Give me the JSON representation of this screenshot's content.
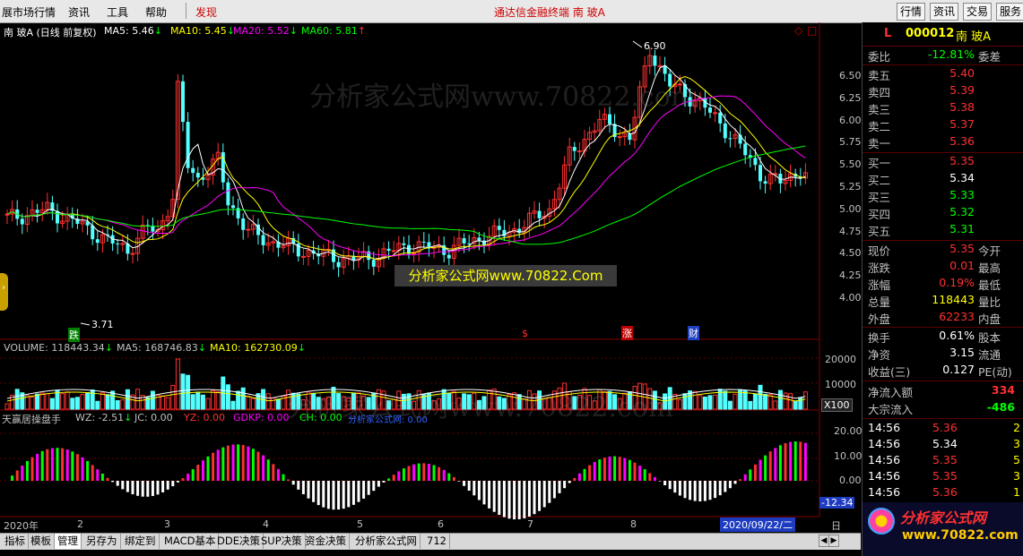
{
  "menu": {
    "items": [
      "展市场行情",
      "资讯",
      "工具",
      "帮助",
      "发现"
    ],
    "center_title": "通达信金融终端   南 玻A",
    "toolbar": [
      "行情",
      "资讯",
      "交易",
      "服务"
    ]
  },
  "main_chart": {
    "stock_label": "南 玻A (日线 前复权)",
    "ma": [
      {
        "label": "MA5: 5.46",
        "arrow": "↓",
        "color": "#ffffff"
      },
      {
        "label": "MA10: 5.45",
        "arrow": "↓",
        "color": "#ffff00"
      },
      {
        "label": "MA20: 5.52",
        "arrow": "↓",
        "color": "#ff00ff"
      },
      {
        "label": "MA60: 5.81",
        "arrow": "↑",
        "color": "#00ff00"
      }
    ],
    "y_ticks": [
      "6.50",
      "6.25",
      "6.00",
      "5.75",
      "5.50",
      "5.25",
      "5.00",
      "4.75",
      "4.50",
      "4.25",
      "4.00"
    ],
    "high_label": "6.90",
    "low_label": "3.71",
    "markers": [
      "跌",
      "$",
      "涨",
      "财"
    ],
    "watermark": "分析家公式网www.70822.com",
    "banner": "分析家公式网www.70822.Com",
    "icons": [
      "diamond-icon",
      "square-icon"
    ]
  },
  "volume_chart": {
    "label": "VOLUME: 118443.34",
    "arrow": "↓",
    "ma5": "MA5: 168746.83",
    "ma5_arrow": "↓",
    "ma10": "MA10: 162730.09",
    "ma10_arrow": "↓",
    "y_ticks": [
      "20000",
      "10000"
    ],
    "unit": "X100"
  },
  "indicator_chart": {
    "name": "天赢居操盘手",
    "items": [
      {
        "label": "WZ: -2.51",
        "arrow": "↓",
        "color": "#c0c0c0"
      },
      {
        "label": "JC: 0.00",
        "arrow": "",
        "color": "#c0c0c0"
      },
      {
        "label": "YZ: 0.00",
        "arrow": "",
        "color": "#ff3030"
      },
      {
        "label": "GDKP: 0.00",
        "arrow": "",
        "color": "#ff00ff"
      },
      {
        "label": "CH: 0.00",
        "arrow": "",
        "color": "#00ff00"
      },
      {
        "label": "分析家公式网: 0.00",
        "arrow": "",
        "color": "#3060ff"
      }
    ],
    "y_ticks": [
      "20.00",
      "10.00",
      "0.00"
    ],
    "current": "-12.34"
  },
  "date_axis": {
    "year": "2020年",
    "months": [
      "2",
      "3",
      "4",
      "5",
      "6",
      "7",
      "8"
    ],
    "current_date": "2020/09/22/二",
    "right_label": "日"
  },
  "tabs": [
    "指标",
    "模板",
    "管理",
    "另存为",
    "绑定到",
    "MACD基本",
    "DDE决策",
    "SUP决策",
    "资金决策",
    "分析家公式网",
    "712"
  ],
  "panel": {
    "code_prefix": "L",
    "code": "000012",
    "name": "南 玻A",
    "weibi_label": "委比",
    "weibi_value": "-12.81%",
    "weicha_label": "委差",
    "sells": [
      {
        "label": "卖五",
        "price": "5.40"
      },
      {
        "label": "卖四",
        "price": "5.39"
      },
      {
        "label": "卖三",
        "price": "5.38"
      },
      {
        "label": "卖二",
        "price": "5.37"
      },
      {
        "label": "卖一",
        "price": "5.36"
      }
    ],
    "buys": [
      {
        "label": "买一",
        "price": "5.35",
        "color": "#ff3030"
      },
      {
        "label": "买二",
        "price": "5.34",
        "color": "#ffffff"
      },
      {
        "label": "买三",
        "price": "5.33",
        "color": "#00ff00"
      },
      {
        "label": "买四",
        "price": "5.32",
        "color": "#00ff00"
      },
      {
        "label": "买五",
        "price": "5.31",
        "color": "#00ff00"
      }
    ],
    "stats": [
      {
        "label": "现价",
        "value": "5.35",
        "color": "#ff3030",
        "label2": "今开"
      },
      {
        "label": "涨跌",
        "value": "0.01",
        "color": "#ff3030",
        "label2": "最高"
      },
      {
        "label": "涨幅",
        "value": "0.19%",
        "color": "#ff3030",
        "label2": "最低"
      },
      {
        "label": "总量",
        "value": "118443",
        "color": "#ffff00",
        "label2": "量比"
      },
      {
        "label": "外盘",
        "value": "62233",
        "color": "#ff3030",
        "label2": "内盘"
      }
    ],
    "stats2": [
      {
        "label": "换手",
        "value": "0.61%",
        "color": "#ffffff",
        "label2": "股本"
      },
      {
        "label": "净资",
        "value": "3.15",
        "color": "#ffffff",
        "label2": "流通"
      },
      {
        "label": "收益(三)",
        "value": "0.127",
        "color": "#ffffff",
        "label2": "PE(动)"
      }
    ],
    "flows": [
      {
        "label": "净流入额",
        "value": "334",
        "color": "#ff3030"
      },
      {
        "label": "大宗流入",
        "value": "-486",
        "color": "#00ff00"
      }
    ],
    "ticks": [
      {
        "time": "14:56",
        "price": "5.36",
        "color": "#ff3030",
        "vol": "2"
      },
      {
        "time": "14:56",
        "price": "5.34",
        "color": "#ffffff",
        "vol": "3"
      },
      {
        "time": "14:56",
        "price": "5.35",
        "color": "#ff3030",
        "vol": "5"
      },
      {
        "time": "14:56",
        "price": "5.35",
        "color": "#ff3030",
        "vol": "3"
      },
      {
        "time": "14:56",
        "price": "5.36",
        "color": "#ff3030",
        "vol": "1"
      }
    ],
    "logo_text": "分析家公式网",
    "logo_url": "www.70822.com"
  }
}
